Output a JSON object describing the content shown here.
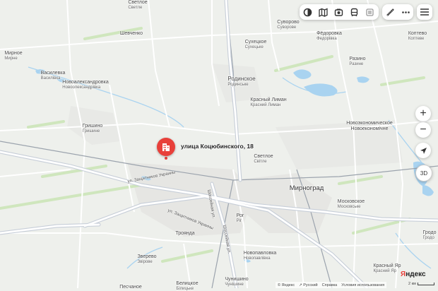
{
  "toolbar": {
    "buttons": [
      {
        "name": "layers-icon"
      },
      {
        "name": "panorama-icon"
      },
      {
        "name": "traffic-icon"
      },
      {
        "name": "transit-icon"
      },
      {
        "name": "parking-icon"
      }
    ],
    "ruler": "ruler-icon",
    "more": "more-icon",
    "menu": "menu-icon"
  },
  "controls": {
    "zoom_in": "+",
    "zoom_out": "−",
    "view_3d": "3D"
  },
  "marker": {
    "label": "улица Коцюбинского, 18"
  },
  "places": [
    {
      "name": "Светлое",
      "sub": "Светле",
      "cls": "s"
    },
    {
      "name": "Шевченко",
      "sub": "",
      "cls": "s"
    },
    {
      "name": "Суворово",
      "sub": "Суворове",
      "cls": "s"
    },
    {
      "name": "Фёдоровка",
      "sub": "Федорівка",
      "cls": "s"
    },
    {
      "name": "Коптево",
      "sub": "Коптеве",
      "cls": "s"
    },
    {
      "name": "Сухецкое",
      "sub": "Сухецьке",
      "cls": "s"
    },
    {
      "name": "Мирное",
      "sub": "Мирне",
      "cls": "s"
    },
    {
      "name": "Разино",
      "sub": "Разине",
      "cls": "s"
    },
    {
      "name": "Василевка",
      "sub": "Василівка",
      "cls": "s"
    },
    {
      "name": "Новоалександровка",
      "sub": "Новоолександрівка",
      "cls": "s"
    },
    {
      "name": "Родинское",
      "sub": "Родинське",
      "cls": "m"
    },
    {
      "name": "Красный Лиман",
      "sub": "Красний Лиман",
      "cls": "s"
    },
    {
      "name": "Новоэкономическое",
      "sub": "",
      "cls": "s"
    },
    {
      "name": "Новоекономічне",
      "sub": "",
      "cls": "s"
    },
    {
      "name": "Гришино",
      "sub": "Гришине",
      "cls": "s"
    },
    {
      "name": "Светлое",
      "sub": "Світле",
      "cls": "s"
    },
    {
      "name": "Мирноград",
      "sub": "",
      "cls": "l"
    },
    {
      "name": "Московское",
      "sub": "Московське",
      "cls": "s"
    },
    {
      "name": "Рог",
      "sub": "Рiг",
      "cls": "s"
    },
    {
      "name": "Троянда",
      "sub": "",
      "cls": "s"
    },
    {
      "name": "Новопавловка",
      "sub": "Новопавлівка",
      "cls": "s"
    },
    {
      "name": "Зверево",
      "sub": "Звірове",
      "cls": "s"
    },
    {
      "name": "Белицкое",
      "sub": "Білицьке",
      "cls": "s"
    },
    {
      "name": "Чунишино",
      "sub": "Чунішине",
      "cls": "s"
    },
    {
      "name": "Красный Яр",
      "sub": "Красний Яр",
      "cls": "s"
    },
    {
      "name": "Гродо",
      "sub": "Гродо",
      "cls": "s"
    },
    {
      "name": "Песчаное",
      "sub": "",
      "cls": "s"
    }
  ],
  "streets": [
    {
      "name": "ул. Защитников Украины"
    },
    {
      "name": "ул. Защитников Украины"
    },
    {
      "name": "Шоссейная ул."
    },
    {
      "name": "Шоссейная ул."
    }
  ],
  "footer": {
    "copyright": "© Яндекс",
    "lang": "Русский",
    "help": "Справка",
    "terms": "Условия использования"
  },
  "logo": {
    "first": "Я",
    "rest": "ндекс"
  },
  "scale": {
    "label": "2 км"
  }
}
